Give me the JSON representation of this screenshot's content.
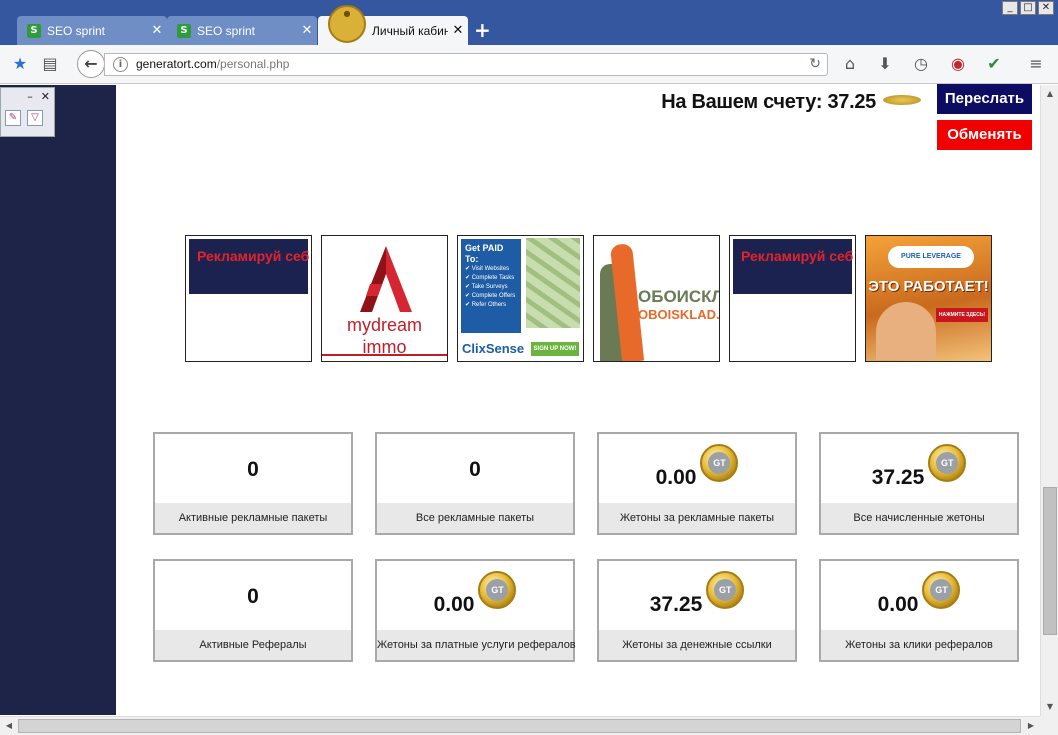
{
  "browser": {
    "tabs": [
      {
        "title": "SEO sprint",
        "icon": "seo-sprint-favicon"
      },
      {
        "title": "SEO sprint",
        "icon": "seo-sprint-favicon"
      },
      {
        "title": "Личный кабинет",
        "icon": "coin-favicon"
      }
    ],
    "url": {
      "domain": "generatort.com",
      "path": "/personal.php"
    },
    "window_buttons": [
      "_",
      "□",
      "✕"
    ]
  },
  "account": {
    "balance_label": "На Вашем счету: 37.25",
    "forward_label": "Переслать",
    "exchange_label": "Обменять"
  },
  "ads": {
    "promo_text": "Рекламируй себ",
    "mydream": {
      "brand_top": "mydream",
      "brand_bottom": "immo"
    },
    "clixsense": {
      "heading": "Get PAID To:",
      "items": [
        "Visit Websites",
        "Complete Tasks",
        "Take Surveys",
        "Complete Offers",
        "Refer Others"
      ],
      "brand": "ClixSense",
      "cta": "SIGN UP NOW!"
    },
    "oboisklad": {
      "line1": "ОБОИСКЛАД",
      "line2": "OBOISKLAD.RU"
    },
    "purelev": {
      "logo": "PURE LEVERAGE",
      "slogan": "ЭТО РАБОТАЕТ!",
      "cta": "НАЖМИТЕ ЗДЕСЬ!"
    }
  },
  "stats": [
    {
      "value": "0",
      "label": "Активные рекламные пакеты",
      "coin": false
    },
    {
      "value": "0",
      "label": "Все рекламные пакеты",
      "coin": false
    },
    {
      "value": "0.00",
      "label": "Жетоны за рекламные пакеты",
      "coin": true
    },
    {
      "value": "37.25",
      "label": "Все начисленные жетоны",
      "coin": true
    },
    {
      "value": "0",
      "label": "Активные Рефералы",
      "coin": false
    },
    {
      "value": "0.00",
      "label": "Жетоны за платные услуги рефералов",
      "coin": true
    },
    {
      "value": "37.25",
      "label": "Жетоны за денежные ссылки",
      "coin": true
    },
    {
      "value": "0.00",
      "label": "Жетоны за клики рефералов",
      "coin": true
    }
  ],
  "coin_text": "GT",
  "colors": {
    "sidebar": "#1e2448",
    "forward_button": "#0c0c62",
    "exchange_button": "#f10000",
    "tabstrip": "#35579f"
  }
}
